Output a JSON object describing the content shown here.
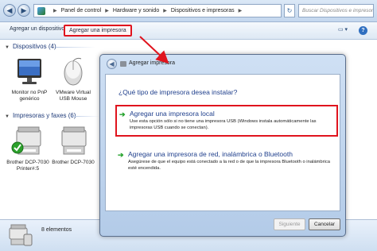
{
  "address_bar": {
    "breadcrumbs": [
      "Panel de control",
      "Hardware y sonido",
      "Dispositivos e impresoras"
    ],
    "search_placeholder": "Buscar Dispositivos e impresoras"
  },
  "toolbar": {
    "add_device": "Agregar un dispositivo",
    "add_printer": "Agregar una impresora",
    "highlight_color": "#e0141e"
  },
  "groups": {
    "devices": {
      "header": "Dispositivos (4)",
      "items": [
        {
          "label": "Monitor no PnP genérico",
          "icon": "monitor-icon"
        },
        {
          "label": "VMware Virtual USB Mouse",
          "icon": "mouse-icon"
        }
      ]
    },
    "printers": {
      "header": "Impresoras y faxes (6)",
      "items": [
        {
          "label": "Brother DCP-7030 Printer#:5",
          "icon": "printer-icon",
          "default": true
        },
        {
          "label": "Brother DCP-7030",
          "icon": "printer-icon"
        }
      ]
    }
  },
  "status": {
    "count": "8 elementos"
  },
  "dialog": {
    "title": "Agregar impresora",
    "question": "¿Qué tipo de impresora desea instalar?",
    "options": [
      {
        "title": "Agregar una impresora local",
        "desc": "Use esta opción sólo si no tiene una impresora USB (Windows instala automáticamente las impresoras USB cuando se conectan)."
      },
      {
        "title": "Agregar una impresora de red, inalámbrica o Bluetooth",
        "desc": "Asegúrese de que el equipo está conectado a la red o de que la impresora Bluetooth o inalámbrica esté encendida."
      }
    ],
    "next": "Siguiente",
    "cancel": "Cancelar"
  }
}
